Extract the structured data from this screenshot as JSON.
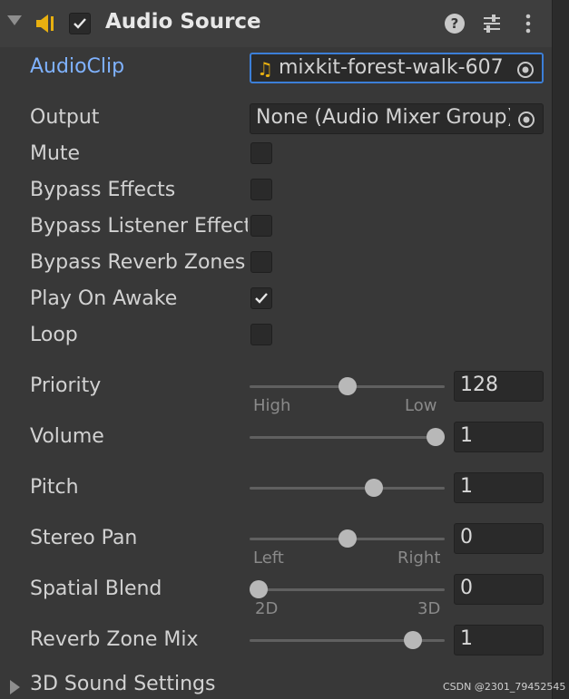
{
  "header": {
    "title": "Audio Source",
    "enabled": true,
    "component_icon": "speaker-icon",
    "buttons": [
      "help-icon",
      "presets-icon",
      "kebab-menu-icon"
    ]
  },
  "fields": {
    "audio_clip": {
      "label": "AudioClip",
      "value": "mixkit-forest-walk-607",
      "icon": "music-note-icon"
    },
    "output": {
      "label": "Output",
      "value": "None (Audio Mixer Group)"
    },
    "mute": {
      "label": "Mute",
      "checked": false
    },
    "bypass_effects": {
      "label": "Bypass Effects",
      "checked": false
    },
    "bypass_listener_effects": {
      "label": "Bypass Listener Effects",
      "checked": false
    },
    "bypass_reverb_zones": {
      "label": "Bypass Reverb Zones",
      "checked": false
    },
    "play_on_awake": {
      "label": "Play On Awake",
      "checked": true
    },
    "loop": {
      "label": "Loop",
      "checked": false
    }
  },
  "sliders": {
    "priority": {
      "label": "Priority",
      "value": "128",
      "fraction": 0.5,
      "min_label": "High",
      "max_label": "Low"
    },
    "volume": {
      "label": "Volume",
      "value": "1",
      "fraction": 1.0
    },
    "pitch": {
      "label": "Pitch",
      "value": "1",
      "fraction": 0.65
    },
    "stereo_pan": {
      "label": "Stereo Pan",
      "value": "0",
      "fraction": 0.5,
      "min_label": "Left",
      "max_label": "Right"
    },
    "spatial_blend": {
      "label": "Spatial Blend",
      "value": "0",
      "fraction": 0.0,
      "min_label": "2D",
      "max_label": "3D"
    },
    "reverb_zone_mix": {
      "label": "Reverb Zone Mix",
      "value": "1",
      "fraction": 0.87
    }
  },
  "footer": {
    "section_label": "3D Sound Settings",
    "expanded": false
  },
  "watermark": "CSDN @2301_79452545",
  "colors": {
    "link": "#7fb2ff",
    "focus": "#3c7fd8",
    "note_icon": "#e8b010"
  }
}
